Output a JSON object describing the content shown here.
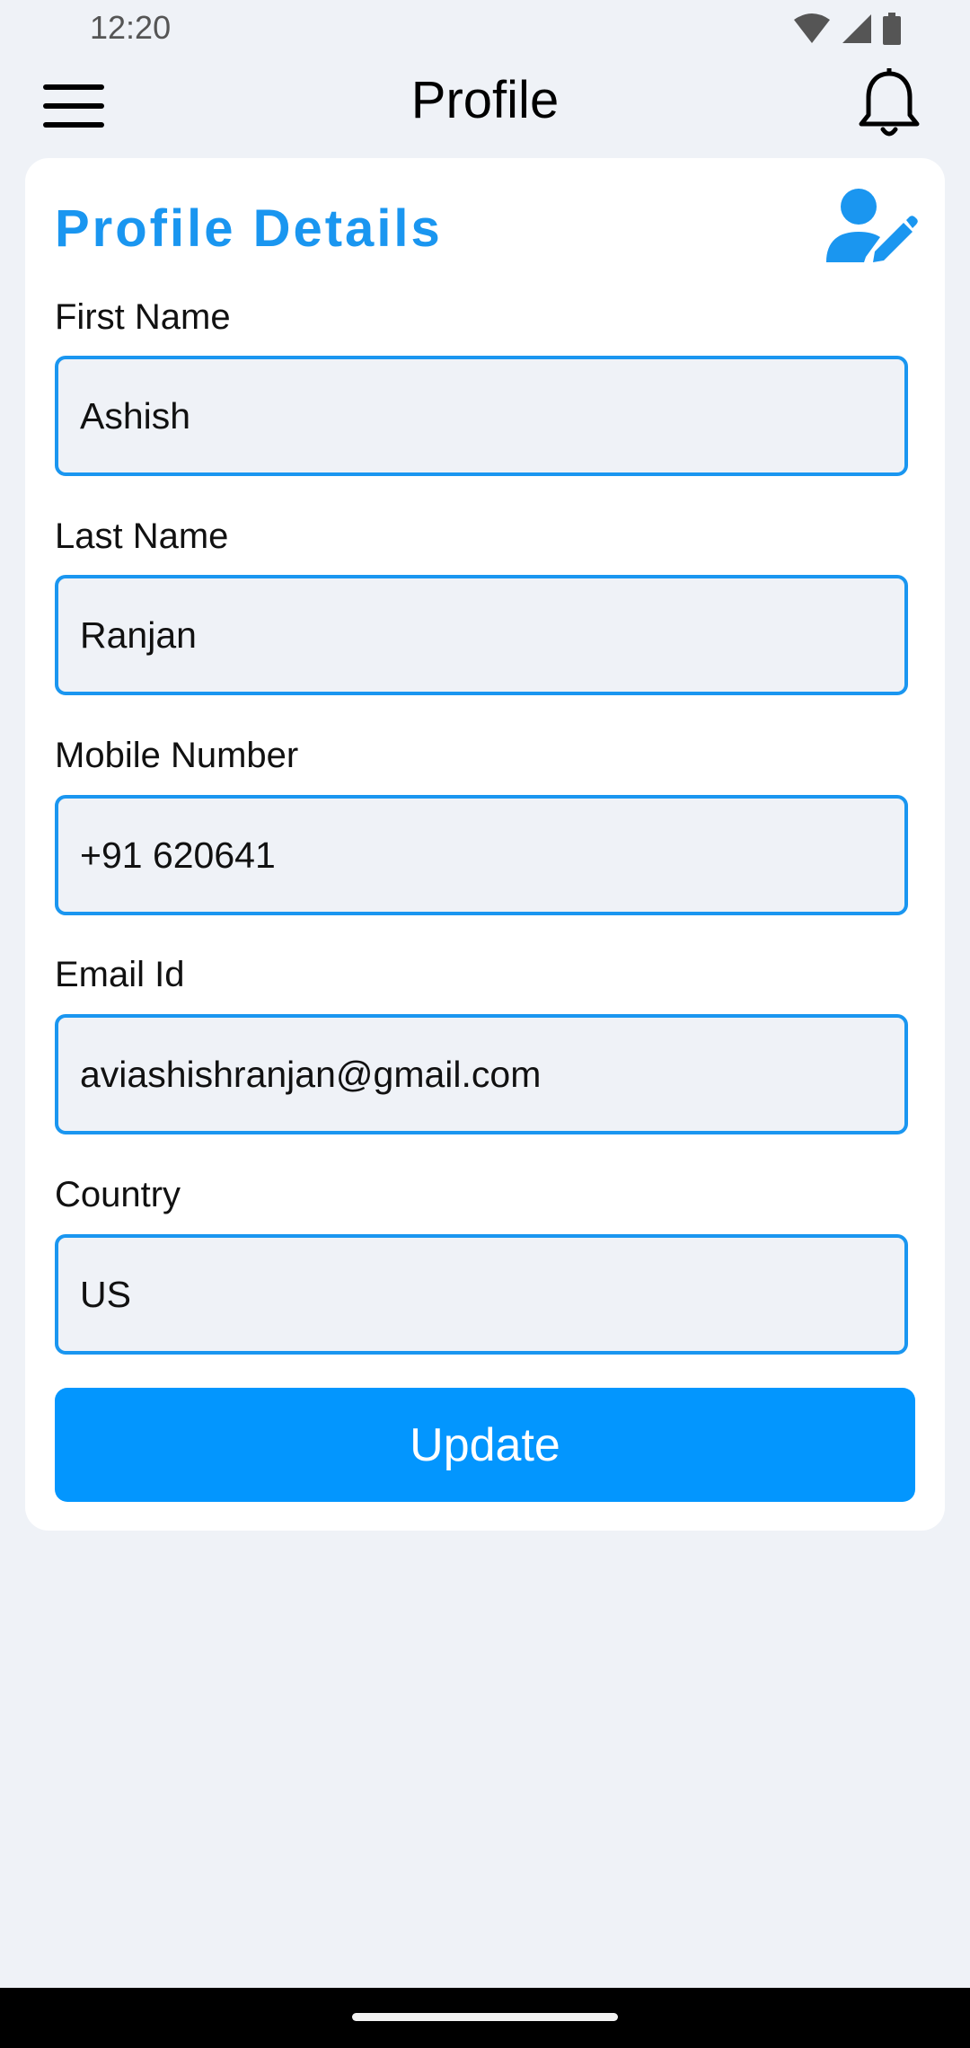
{
  "status_bar": {
    "time": "12:20",
    "icons": [
      "wifi-icon",
      "cellular-signal-icon",
      "battery-icon"
    ]
  },
  "app_bar": {
    "title": "Profile",
    "menu_icon": "hamburger-menu-icon",
    "notification_icon": "bell-icon"
  },
  "profile_card": {
    "title": "Profile Details",
    "edit_icon": "user-edit-icon",
    "fields": [
      {
        "label": "First Name",
        "value": "Ashish"
      },
      {
        "label": "Last Name",
        "value": "Ranjan"
      },
      {
        "label": "Mobile Number",
        "value": "+91 620641"
      },
      {
        "label": "Email Id",
        "value": "aviashishranjan@gmail.com"
      },
      {
        "label": "Country",
        "value": "US"
      }
    ],
    "update_label": "Update"
  },
  "colors": {
    "accent": "#1a96f0",
    "button": "#0396fe",
    "background": "#eff2f7",
    "card": "#ffffff"
  }
}
